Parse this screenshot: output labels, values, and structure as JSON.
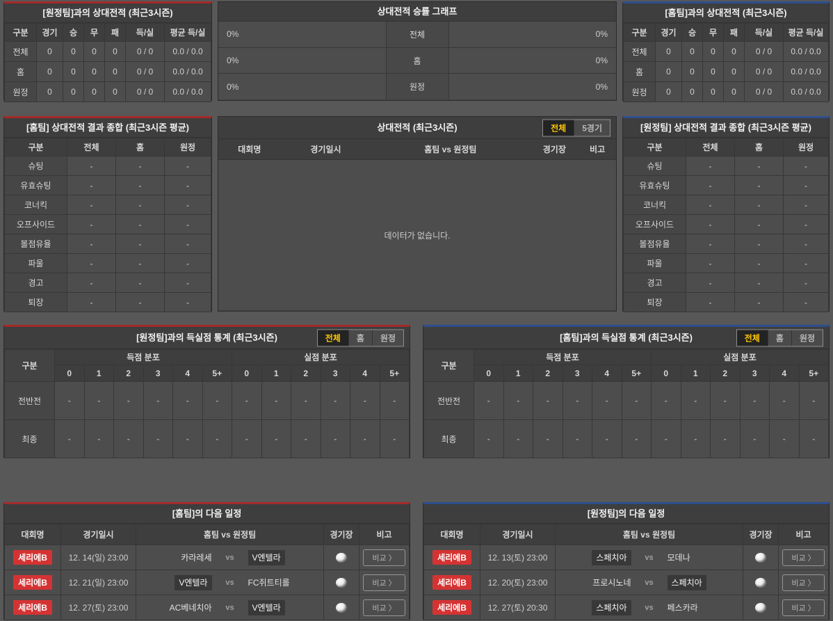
{
  "shared": {
    "vs": "vs",
    "compare": "비교 〉"
  },
  "colors": {
    "home_accent": "#a32a2a",
    "away_accent": "#2d4f8e",
    "active_tab_text": "#ffc600",
    "league_badge": "#d53333"
  },
  "panels": {
    "h2h_away": {
      "title": "[원정팀]과의 상대전적 (최근3시즌)",
      "columns": [
        "구분",
        "경기",
        "승",
        "무",
        "패",
        "득/실",
        "평균 득/실"
      ],
      "rows": [
        {
          "label": "전체",
          "values": [
            "0",
            "0",
            "0",
            "0",
            "0 / 0",
            "0.0 / 0.0"
          ]
        },
        {
          "label": "홈",
          "values": [
            "0",
            "0",
            "0",
            "0",
            "0 / 0",
            "0.0 / 0.0"
          ]
        },
        {
          "label": "원정",
          "values": [
            "0",
            "0",
            "0",
            "0",
            "0 / 0",
            "0.0 / 0.0"
          ]
        }
      ]
    },
    "win_graph": {
      "title": "상대전적 승률 그래프",
      "rows": [
        {
          "label": "전체",
          "left_value": "0%",
          "right_value": "0%"
        },
        {
          "label": "홈",
          "left_value": "0%",
          "right_value": "0%"
        },
        {
          "label": "원정",
          "left_value": "0%",
          "right_value": "0%"
        }
      ]
    },
    "h2h_home": {
      "title": "[홈팀]과의 상대전적 (최근3시즌)",
      "columns": [
        "구분",
        "경기",
        "승",
        "무",
        "패",
        "득/실",
        "평균 득/실"
      ],
      "rows": [
        {
          "label": "전체",
          "values": [
            "0",
            "0",
            "0",
            "0",
            "0 / 0",
            "0.0 / 0.0"
          ]
        },
        {
          "label": "홈",
          "values": [
            "0",
            "0",
            "0",
            "0",
            "0 / 0",
            "0.0 / 0.0"
          ]
        },
        {
          "label": "원정",
          "values": [
            "0",
            "0",
            "0",
            "0",
            "0 / 0",
            "0.0 / 0.0"
          ]
        }
      ]
    },
    "summary_home": {
      "title": "[홈팀] 상대전적 결과 종합 (최근3시즌 평균)",
      "columns": [
        "구분",
        "전체",
        "홈",
        "원정"
      ],
      "rows": [
        {
          "label": "슈팅",
          "values": [
            "-",
            "-",
            "-"
          ]
        },
        {
          "label": "유효슈팅",
          "values": [
            "-",
            "-",
            "-"
          ]
        },
        {
          "label": "코너킥",
          "values": [
            "-",
            "-",
            "-"
          ]
        },
        {
          "label": "오프사이드",
          "values": [
            "-",
            "-",
            "-"
          ]
        },
        {
          "label": "볼점유율",
          "values": [
            "-",
            "-",
            "-"
          ]
        },
        {
          "label": "파울",
          "values": [
            "-",
            "-",
            "-"
          ]
        },
        {
          "label": "경고",
          "values": [
            "-",
            "-",
            "-"
          ]
        },
        {
          "label": "퇴장",
          "values": [
            "-",
            "-",
            "-"
          ]
        }
      ]
    },
    "h2h_list": {
      "title": "상대전적 (최근3시즌)",
      "tabs": [
        {
          "label": "전체",
          "active": true
        },
        {
          "label": "5경기",
          "active": false
        }
      ],
      "columns": [
        "대회명",
        "경기일시",
        "홈팀  vs  원정팀",
        "경기장",
        "비고"
      ],
      "empty_message": "데이터가 없습니다."
    },
    "summary_away": {
      "title": "[원정팀] 상대전적 결과 종합 (최근3시즌 평균)",
      "columns": [
        "구분",
        "전체",
        "홈",
        "원정"
      ],
      "rows": [
        {
          "label": "슈팅",
          "values": [
            "-",
            "-",
            "-"
          ]
        },
        {
          "label": "유효슈팅",
          "values": [
            "-",
            "-",
            "-"
          ]
        },
        {
          "label": "코너킥",
          "values": [
            "-",
            "-",
            "-"
          ]
        },
        {
          "label": "오프사이드",
          "values": [
            "-",
            "-",
            "-"
          ]
        },
        {
          "label": "볼점유율",
          "values": [
            "-",
            "-",
            "-"
          ]
        },
        {
          "label": "파울",
          "values": [
            "-",
            "-",
            "-"
          ]
        },
        {
          "label": "경고",
          "values": [
            "-",
            "-",
            "-"
          ]
        },
        {
          "label": "퇴장",
          "values": [
            "-",
            "-",
            "-"
          ]
        }
      ]
    },
    "goals_away": {
      "title": "[원정팀]과의 득실점 통계 (최근3시즌)",
      "tabs": [
        {
          "label": "전체",
          "active": true
        },
        {
          "label": "홈",
          "active": false
        },
        {
          "label": "원정",
          "active": false
        }
      ],
      "col_label": "구분",
      "groups": [
        {
          "label": "득점 분포"
        },
        {
          "label": "실점 분포"
        }
      ],
      "score_columns": [
        "0",
        "1",
        "2",
        "3",
        "4",
        "5+"
      ],
      "rows": [
        {
          "label": "전반전",
          "values": [
            "-",
            "-",
            "-",
            "-",
            "-",
            "-",
            "-",
            "-",
            "-",
            "-",
            "-",
            "-"
          ]
        },
        {
          "label": "최종",
          "values": [
            "-",
            "-",
            "-",
            "-",
            "-",
            "-",
            "-",
            "-",
            "-",
            "-",
            "-",
            "-"
          ]
        }
      ]
    },
    "goals_home": {
      "title": "[홈팀]과의 득실점 통계 (최근3시즌)",
      "tabs": [
        {
          "label": "전체",
          "active": true
        },
        {
          "label": "홈",
          "active": false
        },
        {
          "label": "원정",
          "active": false
        }
      ],
      "col_label": "구분",
      "groups": [
        {
          "label": "득점 분포"
        },
        {
          "label": "실점 분포"
        }
      ],
      "score_columns": [
        "0",
        "1",
        "2",
        "3",
        "4",
        "5+"
      ],
      "rows": [
        {
          "label": "전반전",
          "values": [
            "-",
            "-",
            "-",
            "-",
            "-",
            "-",
            "-",
            "-",
            "-",
            "-",
            "-",
            "-"
          ]
        },
        {
          "label": "최종",
          "values": [
            "-",
            "-",
            "-",
            "-",
            "-",
            "-",
            "-",
            "-",
            "-",
            "-",
            "-",
            "-"
          ]
        }
      ]
    },
    "next_home": {
      "title": "[홈팀]의 다음 일정",
      "columns": [
        "대회명",
        "경기일시",
        "홈팀  vs  원정팀",
        "경기장",
        "비고"
      ],
      "rows": [
        {
          "league": "세리에B",
          "datetime": "12. 14(일) 23:00",
          "home": "카라레세",
          "away": "V엔텔라",
          "highlight": "away"
        },
        {
          "league": "세리에B",
          "datetime": "12. 21(일) 23:00",
          "home": "V엔텔라",
          "away": "FC쥐트티롤",
          "highlight": "home"
        },
        {
          "league": "세리에B",
          "datetime": "12. 27(토) 23:00",
          "home": "AC베네치아",
          "away": "V엔텔라",
          "highlight": "away"
        }
      ]
    },
    "next_away": {
      "title": "[원정팀]의 다음 일정",
      "columns": [
        "대회명",
        "경기일시",
        "홈팀  vs  원정팀",
        "경기장",
        "비고"
      ],
      "rows": [
        {
          "league": "세리에B",
          "datetime": "12. 13(토) 23:00",
          "home": "스페치아",
          "away": "모데나",
          "highlight": "home"
        },
        {
          "league": "세리에B",
          "datetime": "12. 20(토) 23:00",
          "home": "프로시노네",
          "away": "스페치아",
          "highlight": "away"
        },
        {
          "league": "세리에B",
          "datetime": "12. 27(토) 20:30",
          "home": "스페치아",
          "away": "페스카라",
          "highlight": "home"
        }
      ]
    }
  }
}
